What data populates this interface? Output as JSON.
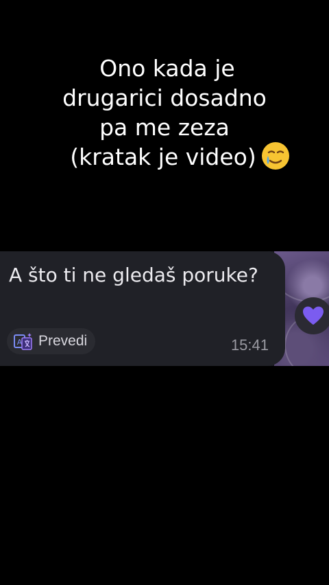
{
  "caption": {
    "line1": "Ono kada je",
    "line2": "drugarici dosadno",
    "line3": "pa me zeza",
    "line4": "(kratak je video)"
  },
  "message": {
    "text": "A što ti ne gledaš poruke?",
    "translate_label": "Prevedi",
    "time": "15:41"
  },
  "icons": {
    "caption_emoji": "face-holding-back-tears-icon",
    "translate": "translate-icon",
    "reaction": "heart-icon"
  },
  "colors": {
    "background": "#000000",
    "bubble": "#202127",
    "accent": "#7b5cf0"
  }
}
